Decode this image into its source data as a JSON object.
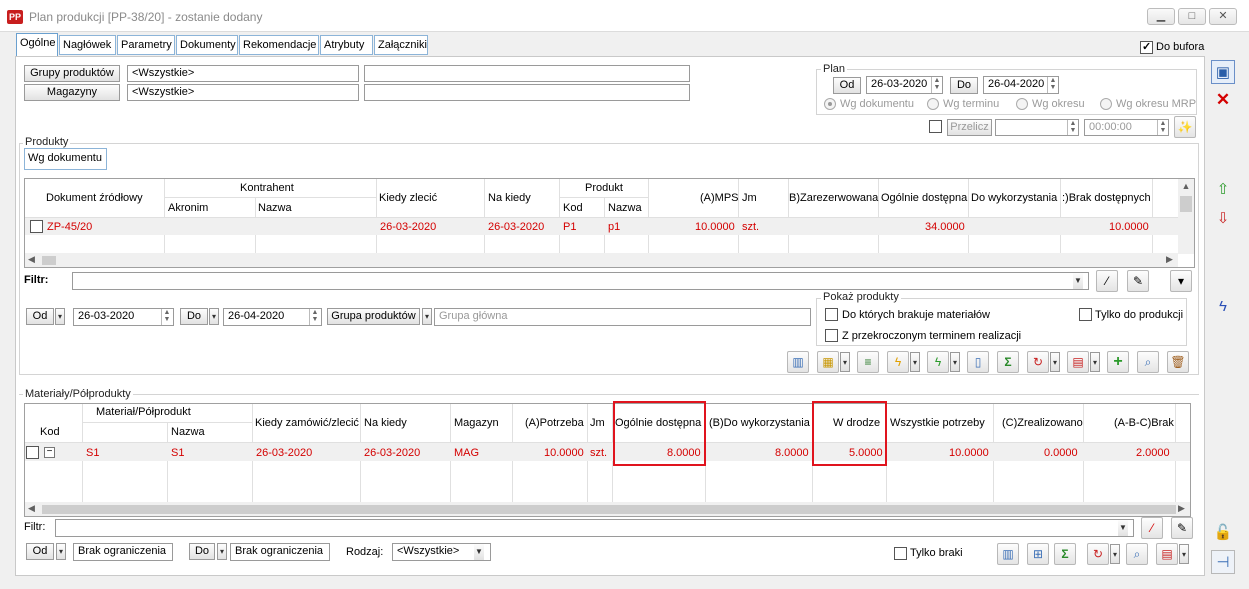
{
  "window": {
    "title": "Plan produkcji [PP-38/20] - zostanie dodany",
    "app_icon_text": "PP"
  },
  "tabs": [
    "Ogólne",
    "Nagłówek",
    "Parametry",
    "Dokumenty",
    "Rekomendacje",
    "Atrybuty",
    "Załączniki"
  ],
  "do_bufora": {
    "label": "Do bufora",
    "checked": true
  },
  "top_filters": {
    "grupy_btn": "Grupy produktów",
    "grupy_value": "<Wszystkie>",
    "magazyny_btn": "Magazyny",
    "magazyny_value": "<Wszystkie>"
  },
  "plan": {
    "title": "Plan",
    "od_btn": "Od",
    "od_value": "26-03-2020",
    "do_btn": "Do",
    "do_value": "26-04-2020",
    "radios": [
      "Wg dokumentu",
      "Wg terminu",
      "Wg okresu",
      "Wg okresu MRP"
    ],
    "przelicz": "Przelicz",
    "time_value": "00:00:00"
  },
  "products": {
    "title": "Produkty",
    "subtab": "Wg dokumentu",
    "headers": {
      "dokument": "Dokument źródłowy",
      "kontrahent": "Kontrahent",
      "akronim": "Akronim",
      "nazwa": "Nazwa",
      "kiedy_zlecic": "Kiedy zlecić",
      "na_kiedy": "Na kiedy",
      "produkt": "Produkt",
      "kod": "Kod",
      "pnazwa": "Nazwa",
      "mps": "(A)MPS",
      "jm": "Jm",
      "zarezerwowana": "B)Zarezerwowana",
      "ogolnie": "Ogólnie dostępna",
      "do_wykorzystania": "Do wykorzystania",
      "brak": ":)Brak dostępnych"
    },
    "row": {
      "dokument": "ZP-45/20",
      "kiedy_zlecic": "26-03-2020",
      "na_kiedy": "26-03-2020",
      "kod": "P1",
      "nazwa": "p1",
      "mps": "10.0000",
      "jm": "szt.",
      "ogolnie": "34.0000",
      "brak": "10.0000"
    },
    "filtr_label": "Filtr:",
    "od_btn": "Od",
    "od_value": "26-03-2020",
    "do_btn": "Do",
    "do_value": "26-04-2020",
    "grupa_btn": "Grupa produktów",
    "grupa_value": "Grupa główna",
    "pokaz": {
      "title": "Pokaż produkty",
      "opt1": "Do których brakuje materiałów",
      "opt2": "Z przekroczonym terminem realizacji",
      "opt3": "Tylko do produkcji"
    }
  },
  "materials": {
    "title": "Materiały/Półprodukty",
    "headers": {
      "material": "Materiał/Półprodukt",
      "kod": "Kod",
      "nazwa": "Nazwa",
      "kiedy": "Kiedy zamówić/zlecić",
      "na_kiedy": "Na kiedy",
      "magazyn": "Magazyn",
      "potrzeba": "(A)Potrzeba",
      "jm": "Jm",
      "ogolnie": "Ogólnie dostępna",
      "do_wyk": "(B)Do wykorzystania",
      "w_drodze": "W drodze",
      "wszystkie": "Wszystkie potrzeby",
      "zrealizowano": "(C)Zrealizowano",
      "brak": "(A-B-C)Brak"
    },
    "row": {
      "kod": "S1",
      "nazwa": "S1",
      "kiedy": "26-03-2020",
      "na_kiedy": "26-03-2020",
      "magazyn": "MAG",
      "potrzeba": "10.0000",
      "jm": "szt.",
      "ogolnie": "8.0000",
      "do_wyk": "8.0000",
      "w_drodze": "5.0000",
      "wszystkie": "10.0000",
      "zrealizowano": "0.0000",
      "brak": "2.0000"
    },
    "filtr_label": "Filtr:",
    "od_btn": "Od",
    "od_value": "Brak ograniczenia",
    "do_btn": "Do",
    "do_value": "Brak ograniczenia",
    "rodzaj_label": "Rodzaj:",
    "rodzaj_value": "<Wszystkie>",
    "tylko_braki": "Tylko braki"
  },
  "colors": {
    "accent_red": "#d40000",
    "highlight": "#e0141e",
    "tab_border": "#8cb4d8"
  }
}
